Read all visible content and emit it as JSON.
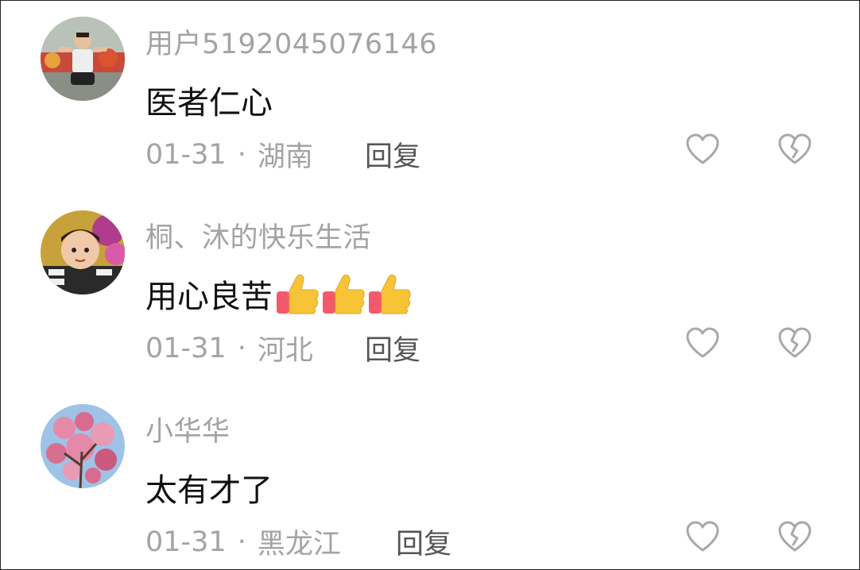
{
  "comments": [
    {
      "username": "用户5192045076146",
      "content": "医者仁心",
      "date": "01-31",
      "separator": "·",
      "location": "湖南",
      "reply_label": "回复",
      "thumbs_count": 0
    },
    {
      "username": "桐、沐的快乐生活",
      "content": "用心良苦",
      "date": "01-31",
      "separator": "·",
      "location": "河北",
      "reply_label": "回复",
      "thumbs_count": 3
    },
    {
      "username": "小华华",
      "content": "太有才了",
      "date": "01-31",
      "separator": "·",
      "location": "黑龙江",
      "reply_label": "回复",
      "thumbs_count": 0
    }
  ],
  "icons": {
    "like": "heart-outline-icon",
    "dislike": "broken-heart-outline-icon",
    "thumbs": "thumbs-up-emoji"
  },
  "colors": {
    "username": "#a3a3a3",
    "content": "#111111",
    "meta": "#a3a3a3",
    "reply": "#555555",
    "icon_stroke": "#a8a8a8"
  }
}
